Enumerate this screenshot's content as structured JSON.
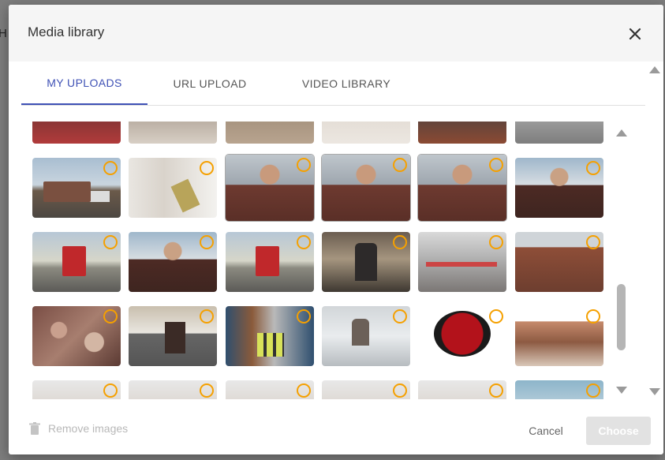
{
  "backdrop": {
    "fragment": "H"
  },
  "dialog": {
    "title": "Media library",
    "close_icon": "close-icon"
  },
  "tabs": [
    {
      "label": "MY UPLOADS",
      "active": true
    },
    {
      "label": "URL UPLOAD",
      "active": false
    },
    {
      "label": "VIDEO LIBRARY",
      "active": false
    }
  ],
  "footer": {
    "remove_label": "Remove images",
    "remove_icon": "trash-icon",
    "cancel_label": "Cancel",
    "choose_label": "Choose"
  },
  "colors": {
    "accent": "#3f51b5",
    "radio": "#f5a000",
    "disabled_button": "#e2e2e2"
  }
}
